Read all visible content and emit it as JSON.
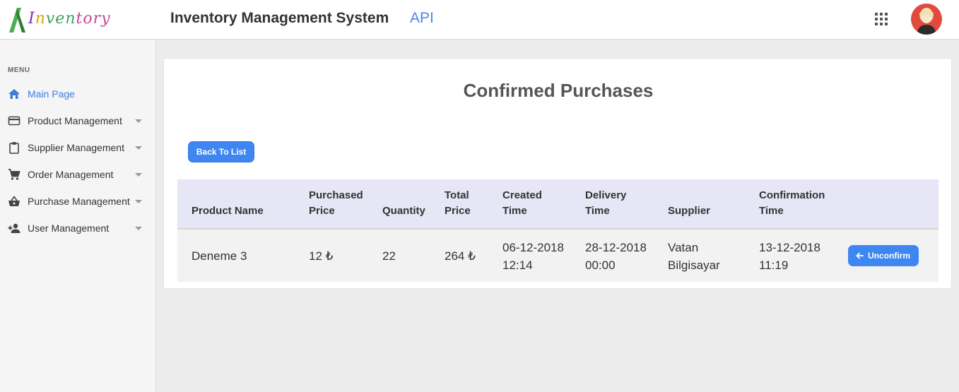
{
  "header": {
    "logo_letters": [
      "I",
      "n",
      "ven",
      "tory"
    ],
    "title": "Inventory Management System",
    "api_link": "API"
  },
  "sidebar": {
    "heading": "MENU",
    "items": [
      {
        "label": "Main Page",
        "icon": "home-icon",
        "active": true
      },
      {
        "label": "Product Management",
        "icon": "card-icon"
      },
      {
        "label": "Supplier Management",
        "icon": "clipboard-icon"
      },
      {
        "label": "Order Management",
        "icon": "cart-icon"
      },
      {
        "label": "Purchase Management",
        "icon": "basket-icon"
      },
      {
        "label": "User Management",
        "icon": "add-user-icon"
      }
    ]
  },
  "main": {
    "title": "Confirmed Purchases",
    "back_button": "Back To List",
    "table": {
      "columns": [
        [
          "Product Name"
        ],
        [
          "Purchased",
          "Price"
        ],
        [
          "Quantity"
        ],
        [
          "Total",
          "Price"
        ],
        [
          "Created",
          "Time"
        ],
        [
          "Delivery",
          "Time"
        ],
        [
          "Supplier"
        ],
        [
          "Confirmation",
          "Time"
        ]
      ],
      "rows": [
        {
          "product_name": "Deneme 3",
          "purchased_price": "12 ₺",
          "quantity": "22",
          "total_price": "264 ₺",
          "created_time": [
            "06-12-2018",
            "12:14"
          ],
          "delivery_time": [
            "28-12-2018",
            "00:00"
          ],
          "supplier": [
            "Vatan",
            "Bilgisayar"
          ],
          "confirmation_time": [
            "13-12-2018",
            "11:19"
          ],
          "action": "Unconfirm"
        }
      ]
    }
  },
  "colors": {
    "accent": "#3e86f2",
    "link": "#4d85e6",
    "table_header_bg": "#e6e6f7",
    "avatar_bg": "#e34a3f"
  }
}
